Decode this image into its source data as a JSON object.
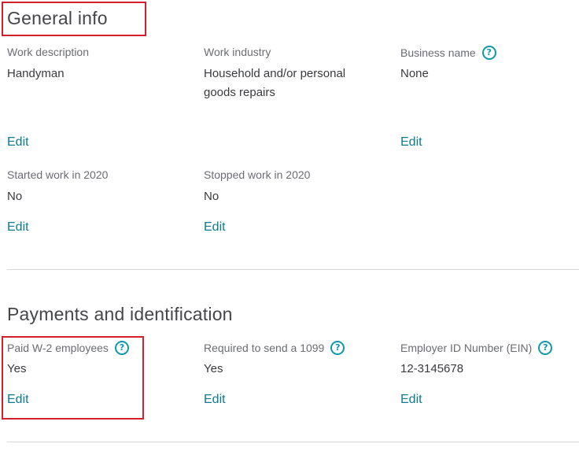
{
  "colors": {
    "accent": "#0d7b8d",
    "help_icon": "#0d9aaa",
    "highlight": "#d4202c",
    "divider": "#d4d7dc"
  },
  "general_info": {
    "title": "General info",
    "fields": [
      {
        "label": "Work description",
        "value": "Handyman",
        "edit": "Edit"
      },
      {
        "label": "Work industry",
        "value": "Household and/or personal goods repairs"
      },
      {
        "label": "Business name",
        "value": "None",
        "edit": "Edit",
        "help_icon": "question-circle-icon"
      },
      {
        "label": "Started work in 2020",
        "value": "No",
        "edit": "Edit"
      },
      {
        "label": "Stopped work in 2020",
        "value": "No",
        "edit": "Edit"
      }
    ]
  },
  "payments": {
    "title": "Payments and identification",
    "fields": [
      {
        "label": "Paid W-2 employees",
        "value": "Yes",
        "edit": "Edit",
        "help_icon": "question-circle-icon"
      },
      {
        "label": "Required to send a 1099",
        "value": "Yes",
        "edit": "Edit",
        "help_icon": "question-circle-icon"
      },
      {
        "label": "Employer ID Number (EIN)",
        "value": "12-3145678",
        "edit": "Edit",
        "help_icon": "question-circle-icon"
      }
    ]
  },
  "help_glyph": "?"
}
